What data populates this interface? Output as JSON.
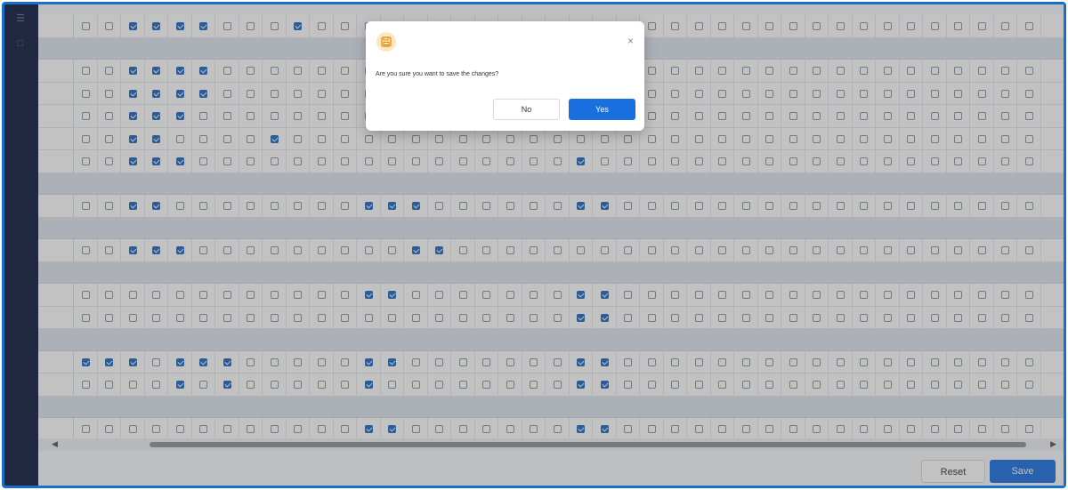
{
  "dialog": {
    "message": "Are you sure you want to save the changes?",
    "no_label": "No",
    "yes_label": "Yes",
    "close_icon": "×",
    "icon": "save-icon"
  },
  "footer": {
    "reset_label": "Reset",
    "save_label": "Save"
  },
  "colors": {
    "accent": "#1a6fe0",
    "sidebar": "#0c1a3e",
    "checked": "#1d67c1",
    "group_row": "#dfe6f1"
  },
  "grid": {
    "columns": 41,
    "rows": [
      {
        "type": "data",
        "checked": [
          2,
          3,
          4,
          5,
          9
        ]
      },
      {
        "type": "group"
      },
      {
        "type": "data",
        "checked": [
          2,
          3,
          4,
          5
        ]
      },
      {
        "type": "data",
        "checked": [
          2,
          3,
          4,
          5
        ]
      },
      {
        "type": "data",
        "checked": [
          2,
          3,
          4
        ]
      },
      {
        "type": "data",
        "checked": [
          2,
          3,
          8
        ]
      },
      {
        "type": "data",
        "checked": [
          2,
          3,
          4,
          21
        ]
      },
      {
        "type": "group"
      },
      {
        "type": "data",
        "checked": [
          2,
          3,
          12,
          13,
          14,
          21,
          22
        ]
      },
      {
        "type": "group"
      },
      {
        "type": "data",
        "checked": [
          2,
          3,
          4,
          14,
          15
        ]
      },
      {
        "type": "group"
      },
      {
        "type": "data",
        "checked": [
          12,
          13,
          21,
          22
        ]
      },
      {
        "type": "data",
        "checked": [
          21,
          22
        ]
      },
      {
        "type": "group"
      },
      {
        "type": "data",
        "checked": [
          0,
          1,
          2,
          4,
          5,
          6,
          12,
          13,
          21,
          22
        ]
      },
      {
        "type": "data",
        "checked": [
          4,
          6,
          12,
          21,
          22
        ]
      },
      {
        "type": "group"
      },
      {
        "type": "data",
        "checked": [
          12,
          13,
          21,
          22
        ]
      }
    ]
  }
}
